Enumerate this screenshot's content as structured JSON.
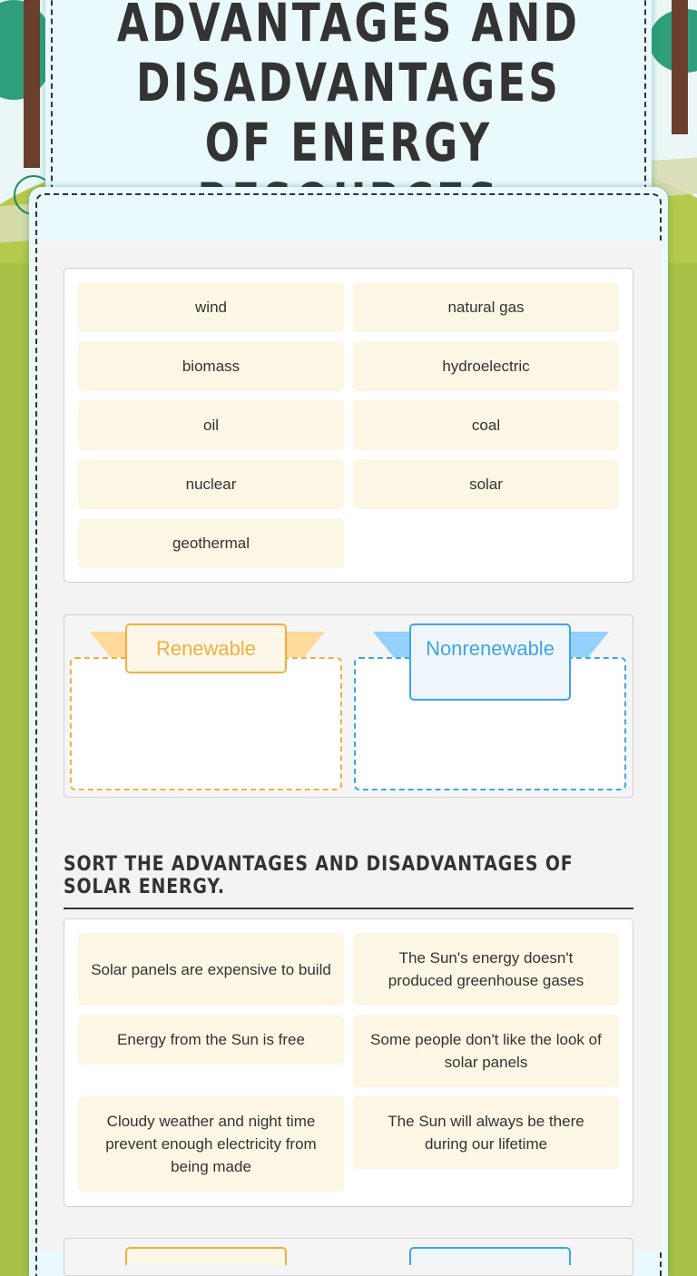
{
  "header": {
    "title": "Advantages and Disadvantages of Energy Resources"
  },
  "activity1": {
    "word_bank": [
      "wind",
      "natural gas",
      "biomass",
      "hydroelectric",
      "oil",
      "coal",
      "nuclear",
      "solar",
      "geothermal"
    ],
    "categories": [
      {
        "label": "Renewable",
        "color": "#f6ae3e"
      },
      {
        "label": "Nonrenewable",
        "color": "#3ea5e6"
      }
    ]
  },
  "activity2": {
    "instruction": "Sort the advantages and disadvantages of solar energy.",
    "statements": [
      "Solar panels are expensive to build",
      "The Sun's energy doesn't produced greenhouse gases",
      "Energy from the Sun is free",
      "Some people don't like the look of solar panels",
      "Cloudy weather and night time prevent enough electricity from being made",
      "The Sun will always be there during our lifetime"
    ]
  },
  "colors": {
    "chip_bg": "#fcf6e4",
    "renewable": "#f6ae3e",
    "nonrenewable": "#3ea5e6",
    "card_bg": "#eaf9fc",
    "grass": "#a9c046"
  }
}
